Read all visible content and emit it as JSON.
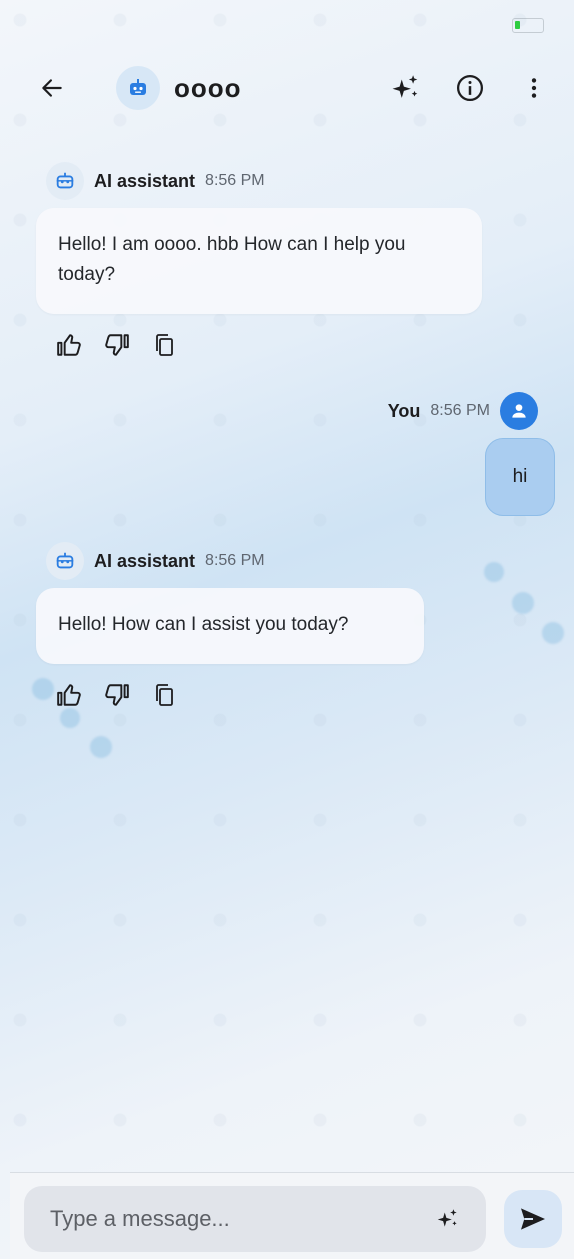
{
  "header": {
    "title": "oooo"
  },
  "messages": [
    {
      "sender": "AI assistant",
      "time": "8:56 PM",
      "text": "Hello! I am oooo. hbb How can I help you today?"
    },
    {
      "sender": "You",
      "time": "8:56 PM",
      "text": "hi"
    },
    {
      "sender": "AI assistant",
      "time": "8:56 PM",
      "text": "Hello! How can I assist you today?"
    }
  ],
  "composer": {
    "placeholder": "Type a message..."
  },
  "icons": {
    "back": "arrow-left-icon",
    "sparkle": "sparkle-icon",
    "info": "info-icon",
    "more": "more-vert-icon",
    "like": "thumb-up-icon",
    "dislike": "thumb-down-icon",
    "copy": "copy-icon",
    "send": "send-icon"
  },
  "colors": {
    "accent": "#2a7de1",
    "user_bubble": "#aacdf0",
    "bot_bubble": "#f7f9fc"
  }
}
